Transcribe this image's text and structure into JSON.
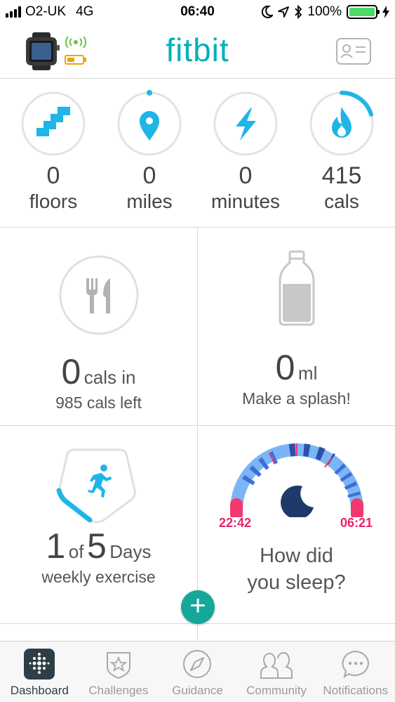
{
  "status_bar": {
    "carrier": "O2-UK",
    "network": "4G",
    "time": "06:40",
    "battery_percent": "100%",
    "battery_color": "#4cd964"
  },
  "header": {
    "logo": "fitbit",
    "accent_color": "#00b0b9"
  },
  "stats": [
    {
      "value": "0",
      "unit": "floors",
      "icon": "stairs-icon",
      "progress": 0.0
    },
    {
      "value": "0",
      "unit": "miles",
      "icon": "location-pin-icon",
      "progress": 0.01
    },
    {
      "value": "0",
      "unit": "minutes",
      "icon": "lightning-icon",
      "progress": 0.0
    },
    {
      "value": "415",
      "unit": "cals",
      "icon": "flame-icon",
      "progress": 0.17
    }
  ],
  "tiles": {
    "food": {
      "value": "0",
      "unit": "cals in",
      "sub": "985 cals left",
      "icon": "fork-knife-icon"
    },
    "water": {
      "value": "0",
      "unit": "ml",
      "sub": "Make a splash!",
      "icon": "water-bottle-icon"
    },
    "exercise": {
      "value": "1",
      "of": "of",
      "target": "5",
      "unit": "Days",
      "sub": "weekly exercise",
      "icon": "running-person-icon"
    },
    "sleep": {
      "start": "22:42",
      "end": "06:21",
      "line1": "How did",
      "line2": "you sleep?",
      "icon": "moon-icon"
    }
  },
  "fab": {
    "label": "+"
  },
  "tabs": [
    {
      "label": "Dashboard",
      "icon": "dashboard-icon",
      "active": true
    },
    {
      "label": "Challenges",
      "icon": "challenges-star-icon",
      "active": false
    },
    {
      "label": "Guidance",
      "icon": "compass-icon",
      "active": false
    },
    {
      "label": "Community",
      "icon": "community-people-icon",
      "active": false
    },
    {
      "label": "Notifications",
      "icon": "chat-bubble-icon",
      "active": false
    }
  ]
}
